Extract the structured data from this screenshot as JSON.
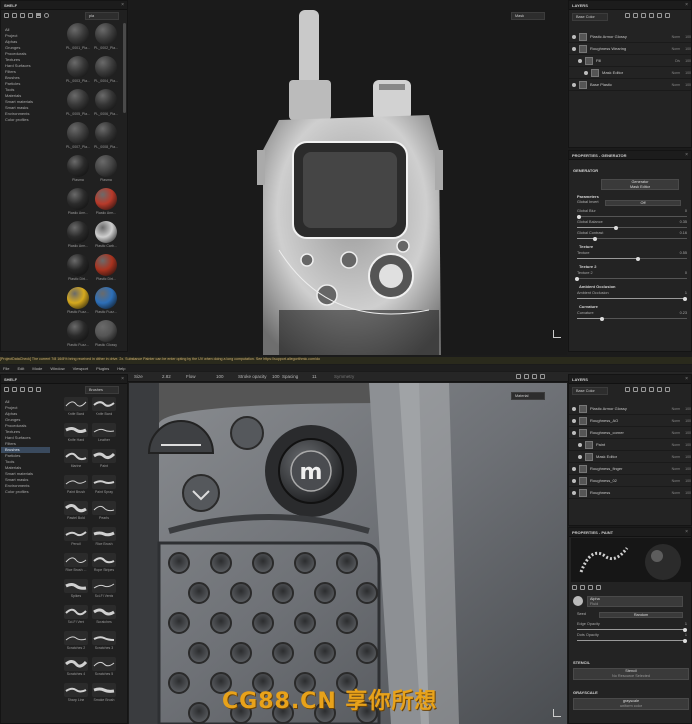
{
  "top": {
    "shelf": {
      "title": "SHELF",
      "search": "pla",
      "categories": [
        "All",
        "Project",
        "Alphas",
        "Grunges",
        "Procedurals",
        "Textures",
        "Hard Surfaces",
        "Filters",
        "Brushes",
        "Particles",
        "Tools",
        "Materials",
        "Smart materials",
        "Smart masks",
        "Environments",
        "Color profiles"
      ],
      "selected_index": -1,
      "thumbs": [
        {
          "label": "PL_0001_Pla...",
          "color": "#3a3a3a"
        },
        {
          "label": "PL_0002_Pla...",
          "color": "#3c3c3c"
        },
        {
          "label": "PL_0003_Pla...",
          "color": "#363636"
        },
        {
          "label": "PL_0004_Pla...",
          "color": "#3b3b3b"
        },
        {
          "label": "PL_0005_Pla...",
          "color": "#383838"
        },
        {
          "label": "PL_0006_Pla...",
          "color": "#343434"
        },
        {
          "label": "PL_0007_Pla...",
          "color": "#3d3d3d"
        },
        {
          "label": "PL_0008_Pla...",
          "color": "#353535"
        },
        {
          "label": "Plasma",
          "color": "#2a2a2a"
        },
        {
          "label": "Plasma",
          "color": "#444444"
        },
        {
          "label": "Plastic Arm...",
          "color": "#2b2b2b"
        },
        {
          "label": "Plastic Arm...",
          "color": "#b83a2a"
        },
        {
          "label": "Plastic Arm...",
          "color": "#2a2a2a"
        },
        {
          "label": "Plastic Carb...",
          "color": "#cfcfcf"
        },
        {
          "label": "Plastic Dirt...",
          "color": "#262626"
        },
        {
          "label": "Plastic Dirt...",
          "color": "#a8331f"
        },
        {
          "label": "Plastic Fuzz...",
          "color": "#d6a91e"
        },
        {
          "label": "Plastic Fuzz...",
          "color": "#2d6fb8"
        },
        {
          "label": "Plastic Fuzz...",
          "color": "#2a2a2a"
        },
        {
          "label": "Plastic Glossy",
          "color": "#555555"
        },
        {
          "label": "Plastic Glossy",
          "color": "#2a7fd6"
        },
        {
          "label": "Plastic Glossy",
          "color": "#c0402c"
        },
        {
          "label": "Plastic Glos...",
          "color": "#303030"
        },
        {
          "label": "Plastic Glos...",
          "color": "#b02e22"
        }
      ]
    },
    "viewport": {
      "mode": "Mask"
    },
    "layers": {
      "title": "LAYERS",
      "channel": "Base Color",
      "rows": [
        {
          "name": "Plastic Armor Glossy",
          "blend": "Norm",
          "opacity": "100",
          "indent": 0
        },
        {
          "name": "Roughness Wearing",
          "blend": "Norm",
          "opacity": "100",
          "indent": 0
        },
        {
          "name": "Fill",
          "blend": "Div",
          "opacity": "100",
          "indent": 1
        },
        {
          "name": "Mask Editor",
          "blend": "Norm",
          "opacity": "100",
          "indent": 2
        },
        {
          "name": "Base Plastic",
          "blend": "Norm",
          "opacity": "100",
          "indent": 0
        }
      ]
    },
    "properties": {
      "title": "PROPERTIES - GENERATOR",
      "section": "GENERATOR",
      "generator_label": "Generator",
      "generator_value": "Mask Editor",
      "params_title": "Parameters",
      "global_invert_label": "Global Invert",
      "global_invert_value": "Off",
      "sliders": [
        {
          "label": "Global Blur",
          "value": "0",
          "fraction": 0.02
        },
        {
          "label": "Global Balance",
          "value": "0.35",
          "fraction": 0.35
        },
        {
          "label": "Global Contrast",
          "value": "0.16",
          "fraction": 0.16
        }
      ],
      "groups": [
        {
          "title": "Texture",
          "slider": {
            "label": "Texture",
            "value": "0.55",
            "fraction": 0.55
          }
        },
        {
          "title": "Texture 2",
          "slider": {
            "label": "Texture 2",
            "value": "0",
            "fraction": 0.0
          }
        },
        {
          "title": "Ambient Occlusion",
          "slider": {
            "label": "Ambient Occlusion",
            "value": "1",
            "fraction": 0.98
          }
        },
        {
          "title": "Curvature",
          "slider": {
            "label": "Curvature",
            "value": "0.23",
            "fraction": 0.23
          }
        }
      ]
    },
    "status": "[ProjectDataCheck] The current 7/8 16/8% bring received in dither in drive. 2x. Substance Painter can be enter opting by the UV when doing a long computation. See https://support.allegorithmic.com/do"
  },
  "bottom": {
    "menu": [
      "File",
      "Edit",
      "Mode",
      "Window",
      "Viewport",
      "Plugins",
      "Help"
    ],
    "toolbar": {
      "size_label": "Size",
      "size_value": "2.82",
      "flow_label": "Flow",
      "flow_value": "100",
      "stroke_opacity_label": "Stroke opacity",
      "stroke_opacity_value": "100",
      "spacing_label": "Spacing",
      "spacing_value": "11",
      "symmetry_label": "Symmetry"
    },
    "shelf": {
      "title": "SHELF",
      "search": "Brushes",
      "categories": [
        "All",
        "Project",
        "Alphas",
        "Grunges",
        "Procedurals",
        "Textures",
        "Hard Surfaces",
        "Filters",
        "Brushes",
        "Particles",
        "Tools",
        "Materials",
        "Smart materials",
        "Smart masks",
        "Environments",
        "Color profiles"
      ],
      "selected_index": 8,
      "thumbs": [
        "Knife Bank",
        "Knife Bank",
        "Knife Hard",
        "Leather",
        "Marine",
        "Paint",
        "Paint Brush",
        "Paint Spray",
        "Pastel Bold",
        "Pearls",
        "Pencil",
        "Rice Brush",
        "Rice Brush ...",
        "Rope Stripes",
        "Spikes",
        "Sci-Fi Vents",
        "Sci-Fi Vent",
        "Scratches",
        "Scratches 2",
        "Scratches 3",
        "Scratches 4",
        "Scratches 5",
        "Sharp Line",
        "Smoke Brush"
      ]
    },
    "viewport": {
      "mode": "Material"
    },
    "layers": {
      "title": "LAYERS",
      "channel": "Base Color",
      "rows": [
        {
          "name": "Plastic Armor Glossy",
          "blend": "Norm",
          "opacity": "100",
          "indent": 0
        },
        {
          "name": "Roughness_AO",
          "blend": "Norm",
          "opacity": "100",
          "indent": 0
        },
        {
          "name": "Roughness_corner",
          "blend": "Norm",
          "opacity": "100",
          "indent": 0
        },
        {
          "name": "Paint",
          "blend": "Norm",
          "opacity": "100",
          "indent": 1
        },
        {
          "name": "Mask Editor",
          "blend": "Norm",
          "opacity": "100",
          "indent": 1
        },
        {
          "name": "Roughness_finger",
          "blend": "Norm",
          "opacity": "100",
          "indent": 0
        },
        {
          "name": "Roughness_02",
          "blend": "Norm",
          "opacity": "100",
          "indent": 0
        },
        {
          "name": "Roughness",
          "blend": "Norm",
          "opacity": "100",
          "indent": 0
        }
      ]
    },
    "properties": {
      "title": "PROPERTIES - PAINT",
      "alpha_title": "Alpha",
      "alpha_value": "Fluid",
      "seed_label": "Seed",
      "seed_value": "Random",
      "sliders": [
        {
          "label": "Edge Opacity",
          "value": "1",
          "fraction": 0.98
        },
        {
          "label": "Dots Opacity",
          "value": "1",
          "fraction": 0.98
        }
      ],
      "stencil_title": "STENCIL",
      "stencil_btn": "Stencil",
      "stencil_sub": "No Resource Selected",
      "grayscale_title": "GRAYSCALE",
      "grayscale_btn": "grayscale",
      "grayscale_sub": "uniform color"
    }
  },
  "watermark": "CG88.CN 享你所想"
}
